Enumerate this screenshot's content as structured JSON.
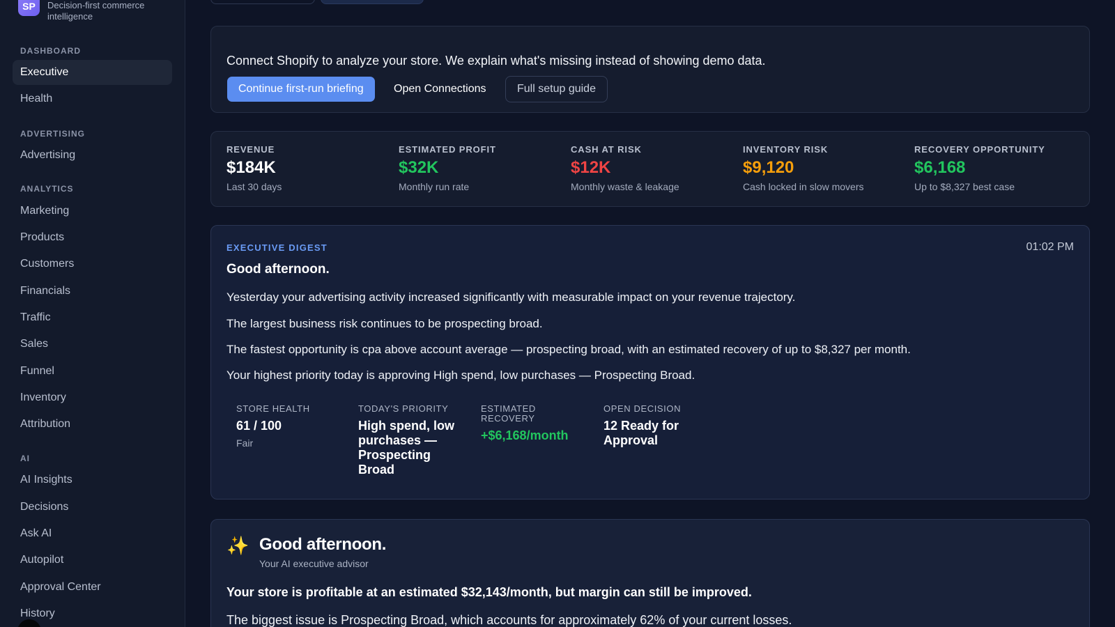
{
  "brand": {
    "logo_text": "SP",
    "tagline": "Decision-first commerce intelligence"
  },
  "sidebar": {
    "sections": [
      {
        "title": "DASHBOARD",
        "items": [
          {
            "label": "Executive",
            "active": true
          },
          {
            "label": "Health"
          }
        ]
      },
      {
        "title": "ADVERTISING",
        "items": [
          {
            "label": "Advertising"
          }
        ]
      },
      {
        "title": "ANALYTICS",
        "items": [
          {
            "label": "Marketing"
          },
          {
            "label": "Products"
          },
          {
            "label": "Customers"
          },
          {
            "label": "Financials"
          },
          {
            "label": "Traffic"
          },
          {
            "label": "Sales"
          },
          {
            "label": "Funnel"
          },
          {
            "label": "Inventory"
          },
          {
            "label": "Attribution"
          }
        ]
      },
      {
        "title": "AI",
        "items": [
          {
            "label": "AI Insights"
          },
          {
            "label": "Decisions"
          },
          {
            "label": "Ask AI"
          },
          {
            "label": "Autopilot"
          },
          {
            "label": "Approval Center"
          },
          {
            "label": "History"
          }
        ]
      }
    ]
  },
  "onboarding": {
    "message": "Connect Shopify to analyze your store. We explain what's missing instead of showing demo data.",
    "primary_button": "Continue first-run briefing",
    "link_button": "Open Connections",
    "outline_button": "Full setup guide"
  },
  "kpis": [
    {
      "label": "REVENUE",
      "value": "$184K",
      "sub": "Last 30 days",
      "color": "#ffffff"
    },
    {
      "label": "ESTIMATED PROFIT",
      "value": "$32K",
      "sub": "Monthly run rate",
      "color": "#22c55e"
    },
    {
      "label": "CASH AT RISK",
      "value": "$12K",
      "sub": "Monthly waste & leakage",
      "color": "#ef4444"
    },
    {
      "label": "INVENTORY RISK",
      "value": "$9,120",
      "sub": "Cash locked in slow movers",
      "color": "#f59e0b"
    },
    {
      "label": "RECOVERY OPPORTUNITY",
      "value": "$6,168",
      "sub": "Up to $8,327 best case",
      "color": "#22c55e"
    }
  ],
  "digest": {
    "label": "EXECUTIVE DIGEST",
    "time": "01:02 PM",
    "greeting": "Good afternoon.",
    "lines": [
      "Yesterday your advertising activity increased significantly with measurable impact on your revenue trajectory.",
      "The largest business risk continues to be prospecting broad.",
      "The fastest opportunity is cpa above account average — prospecting broad, with an estimated recovery of up to $8,327 per month.",
      "Your highest priority today is approving High spend, low purchases — Prospecting Broad."
    ],
    "stats": {
      "store_health": {
        "label": "STORE HEALTH",
        "value": "61 / 100",
        "sub": "Fair"
      },
      "priority": {
        "label": "TODAY'S PRIORITY",
        "value": "High spend, low purchases — Prospecting Broad"
      },
      "recovery": {
        "label": "ESTIMATED RECOVERY",
        "value": "+$6,168/month",
        "color": "#22c55e"
      },
      "decision": {
        "label": "OPEN DECISION",
        "value": "12 Ready for Approval"
      }
    }
  },
  "advisor": {
    "icon": "sparkles-icon",
    "title": "Good afternoon.",
    "subtitle": "Your AI executive advisor",
    "headline": "Your store is profitable at an estimated $32,143/month, but margin can still be improved.",
    "body": "The biggest issue is Prospecting Broad, which accounts for approximately 62% of your current losses."
  }
}
